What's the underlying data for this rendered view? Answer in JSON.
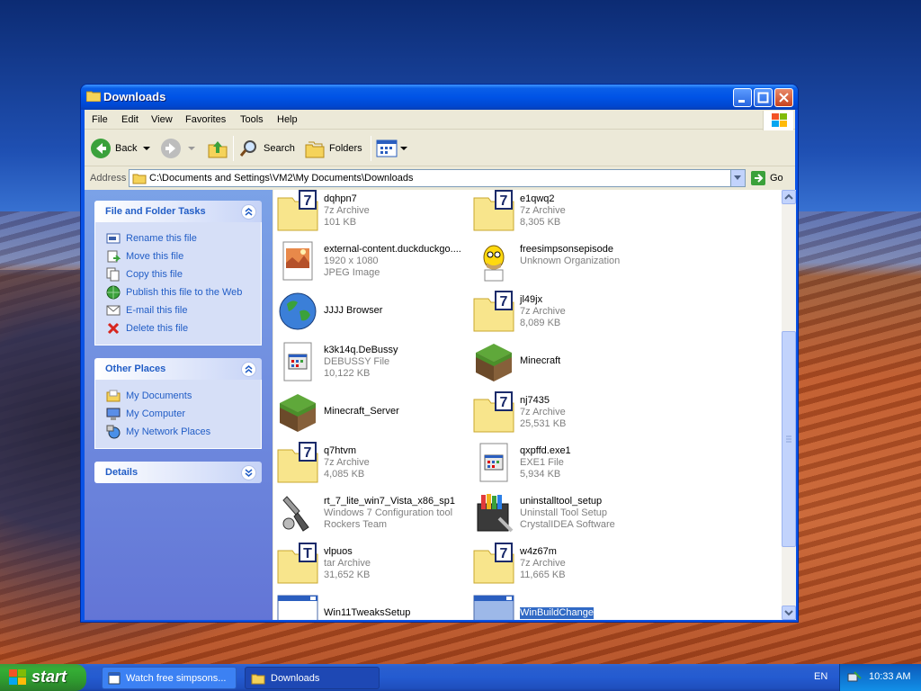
{
  "window": {
    "title": "Downloads"
  },
  "menu": [
    "File",
    "Edit",
    "View",
    "Favorites",
    "Tools",
    "Help"
  ],
  "toolbar": {
    "back": "Back",
    "search": "Search",
    "folders": "Folders"
  },
  "address": {
    "label": "Address",
    "path": "C:\\Documents and Settings\\VM2\\My Documents\\Downloads",
    "go": "Go"
  },
  "tasks_panel": {
    "title": "File and Folder Tasks",
    "items": [
      "Rename this file",
      "Move this file",
      "Copy this file",
      "Publish this file to the Web",
      "E-mail this file",
      "Delete this file"
    ]
  },
  "places_panel": {
    "title": "Other Places",
    "items": [
      "My Documents",
      "My Computer",
      "My Network Places"
    ]
  },
  "details_panel": {
    "title": "Details"
  },
  "files": [
    {
      "name": "dqhpn7",
      "line2": "7z Archive",
      "line3": "101 KB",
      "icon": "7z-archive-icon"
    },
    {
      "name": "e1qwq2",
      "line2": "7z Archive",
      "line3": "8,305 KB",
      "icon": "7z-archive-icon"
    },
    {
      "name": "external-content.duckduckgo....",
      "line2": "1920 x 1080",
      "line3": "JPEG Image",
      "icon": "jpeg-image-icon"
    },
    {
      "name": "freesimpsonsepisode",
      "line2": "Unknown Organization",
      "line3": "",
      "icon": "homer-icon"
    },
    {
      "name": "JJJJ Browser",
      "line2": "",
      "line3": "",
      "icon": "globe-icon"
    },
    {
      "name": "jl49jx",
      "line2": "7z Archive",
      "line3": "8,089 KB",
      "icon": "7z-archive-icon"
    },
    {
      "name": "k3k14q.DeBussy",
      "line2": "DEBUSSY File",
      "line3": "10,122 KB",
      "icon": "generic-file-icon"
    },
    {
      "name": "Minecraft",
      "line2": "",
      "line3": "",
      "icon": "grass-block-icon"
    },
    {
      "name": "Minecraft_Server",
      "line2": "",
      "line3": "",
      "icon": "grass-block-icon"
    },
    {
      "name": "nj7435",
      "line2": "7z Archive",
      "line3": "25,531 KB",
      "icon": "7z-archive-icon"
    },
    {
      "name": "q7htvm",
      "line2": "7z Archive",
      "line3": "4,085 KB",
      "icon": "7z-archive-icon"
    },
    {
      "name": "qxpffd.exe1",
      "line2": "EXE1 File",
      "line3": "5,934 KB",
      "icon": "generic-file-icon"
    },
    {
      "name": "rt_7_lite_win7_Vista_x86_sp1",
      "line2": "Windows 7 Configuration tool",
      "line3": "Rockers Team",
      "icon": "tool-icon"
    },
    {
      "name": "uninstalltool_setup",
      "line2": "Uninstall Tool Setup",
      "line3": "CrystalIDEA Software",
      "icon": "installer-icon"
    },
    {
      "name": "vlpuos",
      "line2": "tar Archive",
      "line3": "31,652 KB",
      "icon": "tar-archive-icon"
    },
    {
      "name": "w4z67m",
      "line2": "7z Archive",
      "line3": "11,665 KB",
      "icon": "7z-archive-icon"
    },
    {
      "name": "Win11TweaksSetup",
      "line2": "",
      "line3": "",
      "icon": "app-window-icon"
    },
    {
      "name": "WinBuildChange",
      "line2": "",
      "line3": "",
      "icon": "app-window-icon",
      "selected": true
    }
  ],
  "taskbar": {
    "start": "start",
    "tasks": [
      "Watch free simpsons...",
      "Downloads"
    ],
    "lang": "EN",
    "clock": "10:33 AM"
  }
}
